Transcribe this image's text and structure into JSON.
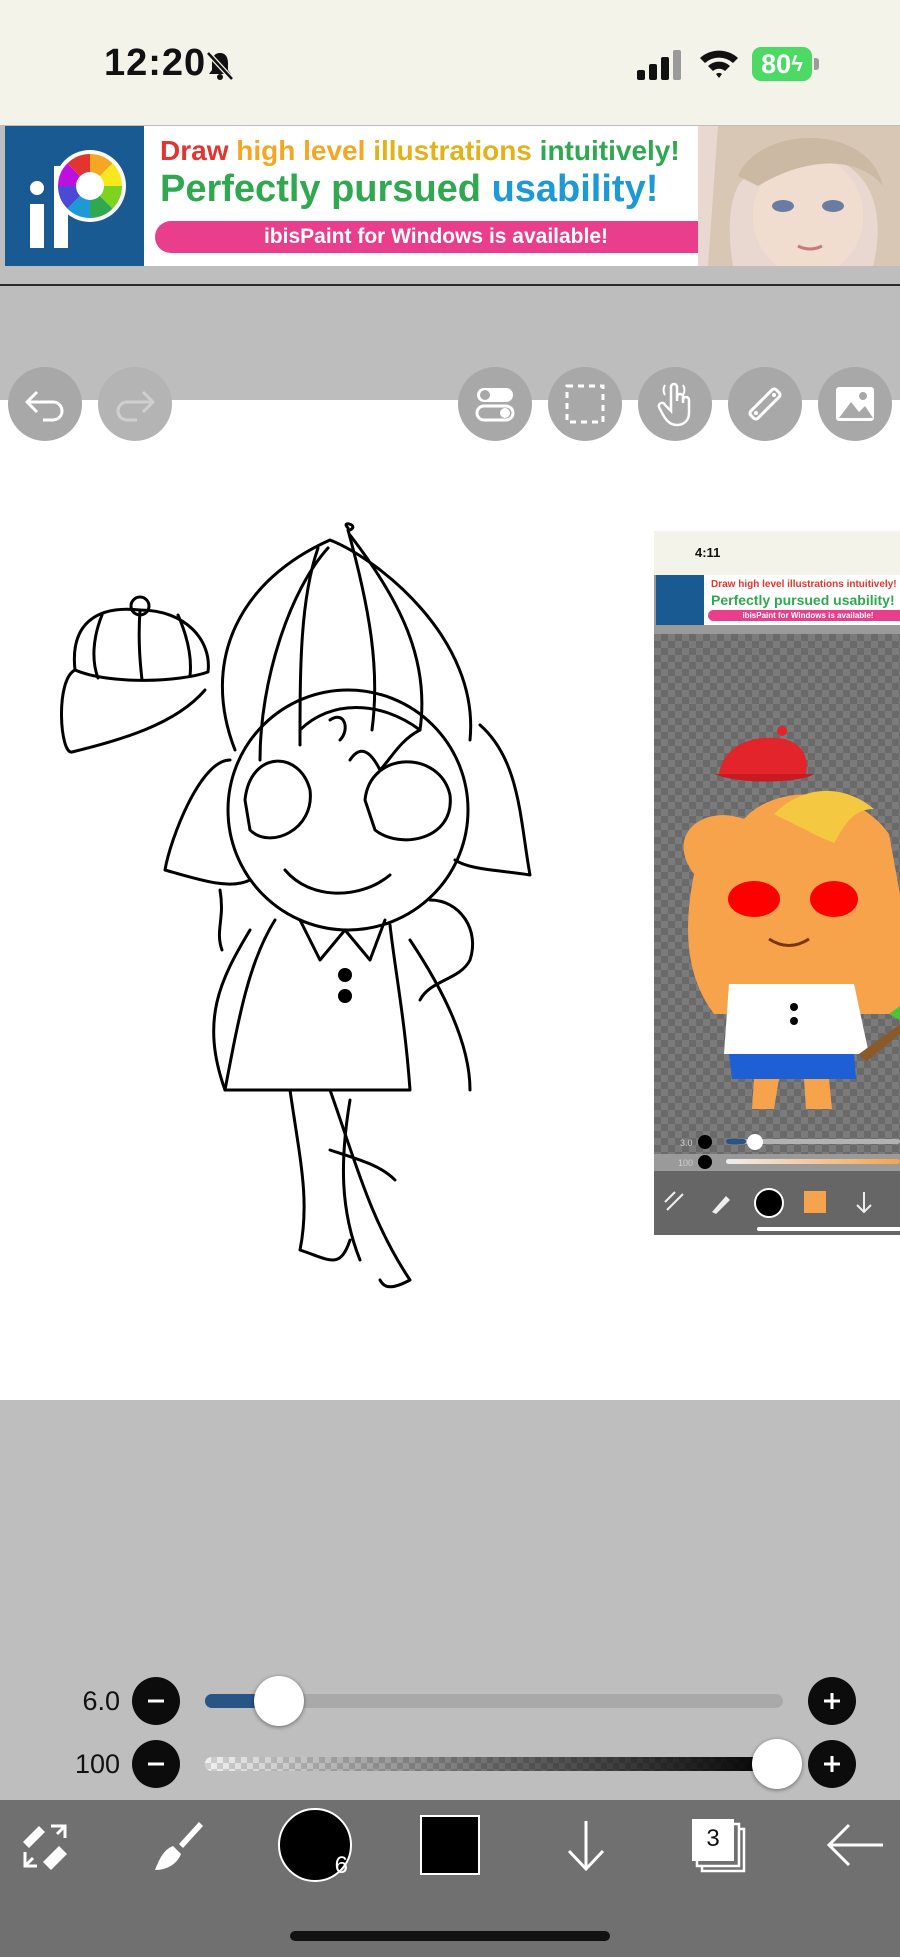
{
  "status_bar": {
    "time": "12:20",
    "battery": "80"
  },
  "ad_banner": {
    "line1_words": [
      "Draw",
      "high level",
      "illustrations",
      "intuitively!"
    ],
    "line2_words": [
      "Perfectly pursued",
      "usability!"
    ],
    "subtitle": "ibisPaint for Windows is available!"
  },
  "toolbar_top": {
    "buttons": [
      "undo",
      "redo",
      "toggle",
      "selection",
      "hand",
      "ruler",
      "reference-image"
    ]
  },
  "reference_window": {
    "time": "4:11",
    "ad_line1": "Draw high level illustrations intuitively!",
    "ad_line2": "Perfectly pursued usability!",
    "ad_subtitle": "ibisPaint for Windows is available!",
    "size_label": "3.0",
    "opacity_label": "100"
  },
  "brush_controls": {
    "size_value": "6.0",
    "size_fraction": 0.11,
    "opacity_value": "100",
    "opacity_fraction": 1.0
  },
  "bottom_toolbar": {
    "brush_size_badge": "6",
    "current_color": "#000000",
    "layer_count": "3"
  },
  "colors": {
    "accent_blue": "#285486",
    "reference_color": "#f7a34c"
  }
}
